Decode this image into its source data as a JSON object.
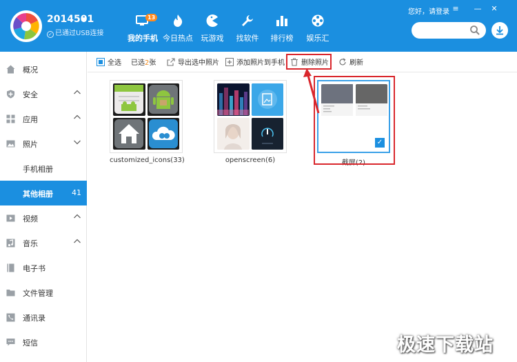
{
  "header": {
    "device_name": "2014501",
    "usb_status": "已通过USB连接",
    "greeting": "您好，请登录",
    "search_placeholder": "",
    "nav_tabs": [
      {
        "label": "我的手机",
        "icon": "phone-icon",
        "badge": "13",
        "active": true
      },
      {
        "label": "今日热点",
        "icon": "flame-icon"
      },
      {
        "label": "玩游戏",
        "icon": "pacman-icon"
      },
      {
        "label": "找软件",
        "icon": "wrench-icon"
      },
      {
        "label": "排行榜",
        "icon": "bar-chart-icon"
      },
      {
        "label": "娱乐汇",
        "icon": "film-reel-icon"
      }
    ],
    "window_controls": [
      "menu-icon",
      "minimize-icon",
      "close-icon"
    ],
    "accent_color": "#1b8fe0"
  },
  "sidebar": {
    "items": [
      {
        "label": "概况",
        "icon": "home-icon"
      },
      {
        "label": "安全",
        "icon": "shield-icon",
        "chevron": "up"
      },
      {
        "label": "应用",
        "icon": "apps-icon",
        "chevron": "up"
      },
      {
        "label": "照片",
        "icon": "image-icon",
        "chevron": "down"
      },
      {
        "label": "手机相册",
        "sub": true
      },
      {
        "label": "其他相册",
        "sub": true,
        "active": true,
        "count": "41"
      },
      {
        "label": "视频",
        "icon": "video-icon",
        "chevron": "up"
      },
      {
        "label": "音乐",
        "icon": "music-icon",
        "chevron": "up"
      },
      {
        "label": "电子书",
        "icon": "book-icon"
      },
      {
        "label": "文件管理",
        "icon": "folder-icon"
      },
      {
        "label": "通讯录",
        "icon": "contacts-icon"
      },
      {
        "label": "短信",
        "icon": "sms-icon"
      }
    ]
  },
  "toolbar": {
    "select_all": "全选",
    "selected_prefix": "已选",
    "selected_count": "2",
    "selected_suffix": "张",
    "export": "导出选中照片",
    "add_to_phone": "添加照片到手机",
    "delete": "删除照片",
    "refresh": "刷新"
  },
  "albums": [
    {
      "name": "customized_icons(33)"
    },
    {
      "name": "openscreen(6)"
    },
    {
      "name": "截屏(2)",
      "selected": true
    }
  ],
  "watermark": "极速下载站"
}
